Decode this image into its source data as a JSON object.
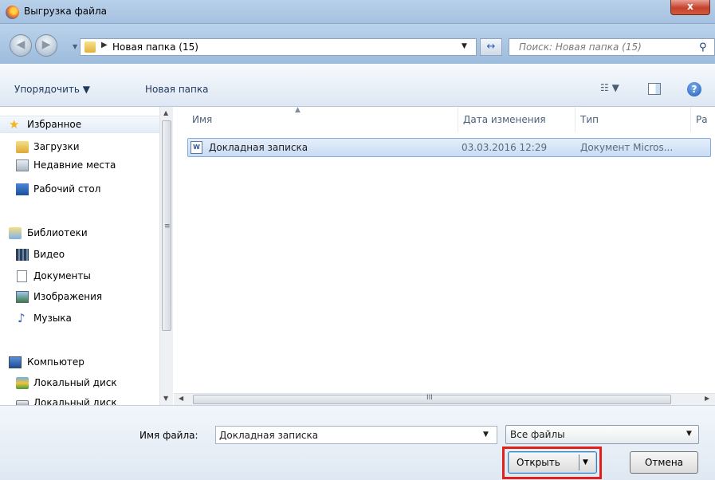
{
  "window": {
    "title": "Выгрузка файла",
    "close_glyph": "x"
  },
  "address": {
    "path_arrow": "▶",
    "path": "Новая папка (15)",
    "search_placeholder": "Поиск: Новая папка (15)"
  },
  "toolbar": {
    "organize_label": "Упорядочить ▼",
    "new_folder_label": "Новая папка",
    "view_glyph": "☷ ▼",
    "help_glyph": "?"
  },
  "nav": {
    "favorites": "Избранное",
    "downloads": "Загрузки",
    "recent": "Недавние места",
    "desktop": "Рабочий стол",
    "libraries": "Библиотеки",
    "video": "Видео",
    "documents": "Документы",
    "images": "Изображения",
    "music": "Музыка",
    "computer": "Компьютер",
    "local_disk_1": "Локальный диск",
    "local_disk_2": "Локальный диск"
  },
  "columns": {
    "name": "Имя",
    "date": "Дата изменения",
    "type": "Тип",
    "size": "Ра"
  },
  "files": [
    {
      "name": "Докладная записка",
      "date": "03.03.2016 12:29",
      "type": "Документ Micros..."
    }
  ],
  "bottom": {
    "filename_label": "Имя файла:",
    "filename_value": "Докладная записка",
    "filetype_value": "Все файлы",
    "open_label": "Открыть",
    "cancel_label": "Отмена"
  },
  "colors": {
    "highlight": "#e2211c",
    "selection": "#c8dcf4"
  }
}
